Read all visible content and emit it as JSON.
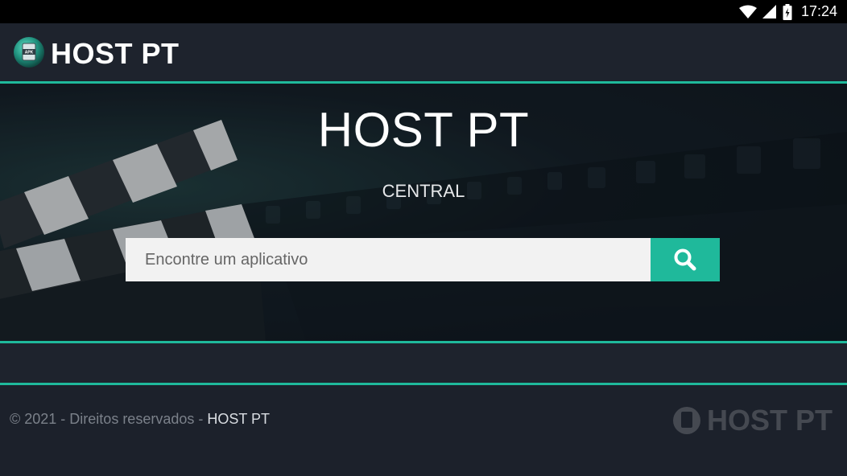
{
  "status_bar": {
    "time": "17:24",
    "icons": [
      "wifi-icon",
      "signal-icon",
      "battery-icon"
    ]
  },
  "header": {
    "logo_icon": "apk-logo-icon",
    "logo_icon_label": "APK",
    "title": "HOST PT"
  },
  "hero": {
    "title": "HOST PT",
    "subtitle": "CENTRAL",
    "search": {
      "placeholder": "Encontre um aplicativo",
      "value": "",
      "button_icon": "search-icon"
    }
  },
  "footer": {
    "copyright": "© 2021 - Direitos reservados - ",
    "brand_link": "HOST PT",
    "logo_text": "HOST PT"
  },
  "colors": {
    "accent": "#1fb99b",
    "background": "#1c212b",
    "status_bar": "#000000"
  }
}
